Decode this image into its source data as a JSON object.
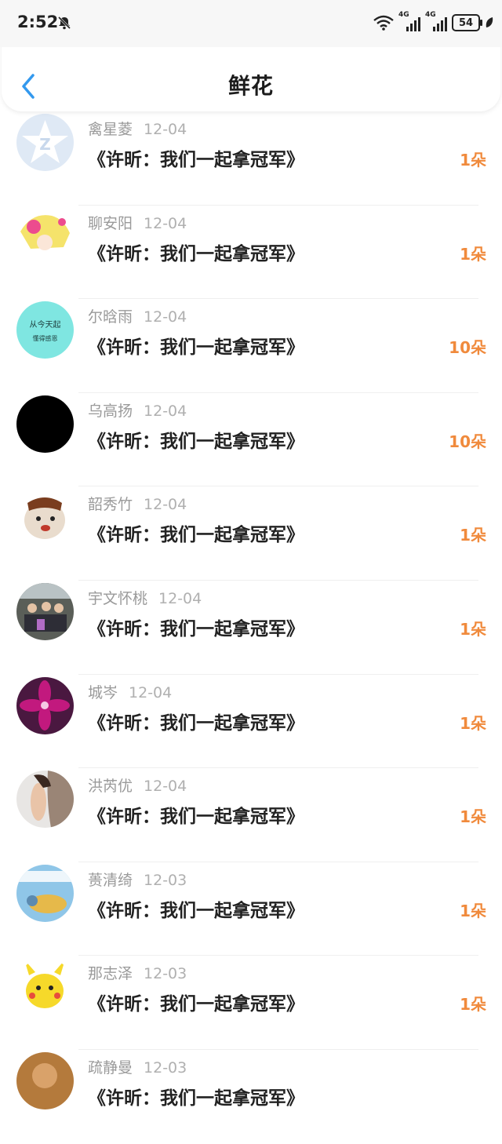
{
  "status": {
    "time": "2:52",
    "net1": "4G",
    "net2": "4G",
    "battery": "54"
  },
  "header": {
    "title": "鲜花"
  },
  "items": [
    {
      "name": "禽星菱",
      "date": "12-04",
      "gift": "《许昕：我们一起拿冠军》",
      "count": "1朵",
      "avatar_color": "#dfe9f5"
    },
    {
      "name": "聊安阳",
      "date": "12-04",
      "gift": "《许昕：我们一起拿冠军》",
      "count": "1朵",
      "avatar_color": "#f5e36b"
    },
    {
      "name": "尔晗雨",
      "date": "12-04",
      "gift": "《许昕：我们一起拿冠军》",
      "count": "10朵",
      "avatar_color": "#7fe6e1",
      "avatar_text1": "从今天起",
      "avatar_text2": "懂得感恩"
    },
    {
      "name": "乌高扬",
      "date": "12-04",
      "gift": "《许昕：我们一起拿冠军》",
      "count": "10朵",
      "avatar_color": "#000000"
    },
    {
      "name": "韶秀竹",
      "date": "12-04",
      "gift": "《许昕：我们一起拿冠军》",
      "count": "1朵",
      "avatar_color": "#e9dccd"
    },
    {
      "name": "宇文怀桃",
      "date": "12-04",
      "gift": "《许昕：我们一起拿冠军》",
      "count": "1朵",
      "avatar_color": "#5a5e58"
    },
    {
      "name": "城岑",
      "date": "12-04",
      "gift": "《许昕：我们一起拿冠军》",
      "count": "1朵",
      "avatar_color": "#c2197e"
    },
    {
      "name": "洪芮优",
      "date": "12-04",
      "gift": "《许昕：我们一起拿冠军》",
      "count": "1朵",
      "avatar_color": "#9a8576"
    },
    {
      "name": "蒉清绮",
      "date": "12-03",
      "gift": "《许昕：我们一起拿冠军》",
      "count": "1朵",
      "avatar_color": "#8fc6e8"
    },
    {
      "name": "那志泽",
      "date": "12-03",
      "gift": "《许昕：我们一起拿冠军》",
      "count": "1朵",
      "avatar_color": "#f6d92a"
    },
    {
      "name": "疏静曼",
      "date": "12-03",
      "gift": "《许昕：我们一起拿冠军》",
      "count": "",
      "avatar_color": "#b47a3c"
    }
  ]
}
